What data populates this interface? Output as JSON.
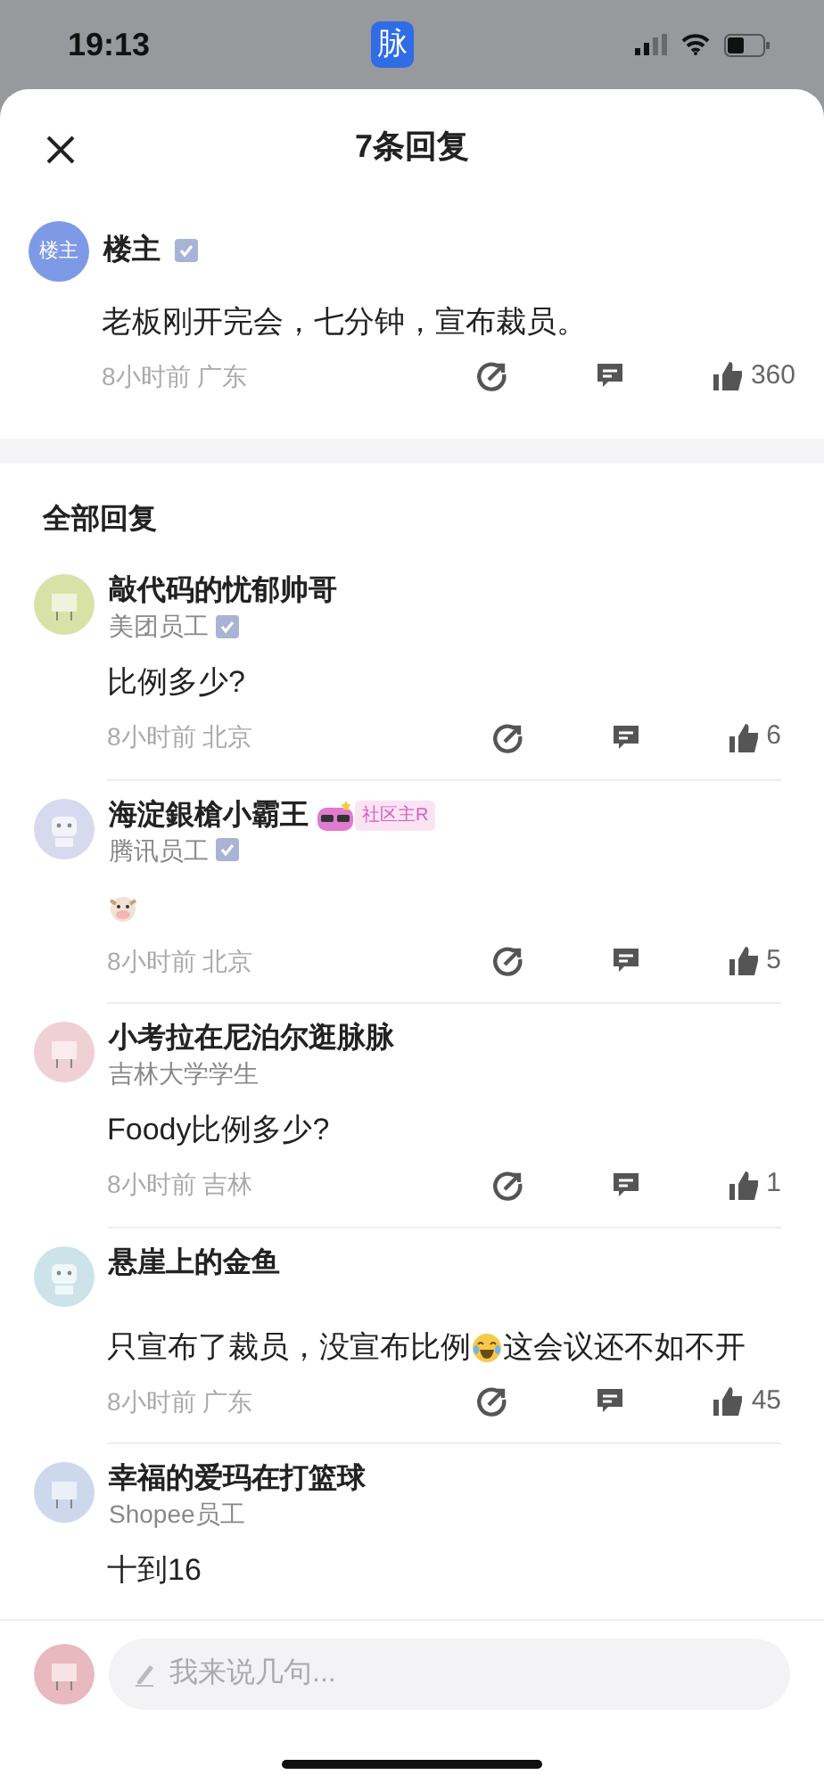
{
  "status_bar": {
    "time": "19:13",
    "app_badge": "脉"
  },
  "header": {
    "title": "7条回复"
  },
  "original_post": {
    "avatar_label": "楼主",
    "author": "楼主",
    "verified": true,
    "text": "老板刚开完会，七分钟，宣布裁员。",
    "time": "8小时前",
    "location": "广东",
    "likes": "360"
  },
  "section_title": "全部回复",
  "replies": [
    {
      "author": "敲代码的忧郁帅哥",
      "color": "#d9e2a6",
      "affiliation": "美团员工",
      "verified": true,
      "content": [
        {
          "kind": "text",
          "text": "比例多少?"
        }
      ],
      "time": "8小时前",
      "location": "北京",
      "likes": "6"
    },
    {
      "author": "海淀銀槍小霸王",
      "color": "#d7d9ef",
      "badge": "社区主R",
      "affiliation": "腾讯员工",
      "verified": true,
      "content": [
        {
          "kind": "cow"
        }
      ],
      "time": "8小时前",
      "location": "北京",
      "likes": "5"
    },
    {
      "author": "小考拉在尼泊尔逛脉脉",
      "color": "#efd0d5",
      "affiliation": "吉林大学学生",
      "verified": false,
      "content": [
        {
          "kind": "text",
          "text": "Foody比例多少?"
        }
      ],
      "time": "8小时前",
      "location": "吉林",
      "likes": "1"
    },
    {
      "author": "悬崖上的金鱼",
      "color": "#cde3ea",
      "verified": false,
      "content": [
        {
          "kind": "text",
          "text": "只宣布了裁员，没宣布比例"
        },
        {
          "kind": "laugh"
        },
        {
          "kind": "text",
          "text": "这会议还不如不开"
        }
      ],
      "time": "8小时前",
      "location": "广东",
      "likes": "45"
    },
    {
      "author": "幸福的爱玛在打篮球",
      "color": "#cdd8ec",
      "affiliation": "Shopee员工",
      "verified": false,
      "content": [
        {
          "kind": "text",
          "text": "十到16"
        }
      ]
    }
  ],
  "composer": {
    "placeholder": "我来说几句...",
    "color": "#e8b9be"
  }
}
